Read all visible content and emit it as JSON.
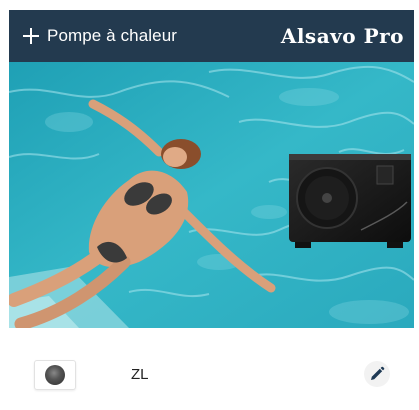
{
  "header": {
    "add_label": "Pompe à chaleur",
    "brand": "Alsavo Pro",
    "background_color": "#233a4f"
  },
  "hero": {
    "image": "woman floating in pool beside heat pump unit"
  },
  "devices": [
    {
      "name": "ZL",
      "thumbnail_icon": "heat-pump-fan-icon",
      "action_icon": "pencil-icon"
    }
  ]
}
